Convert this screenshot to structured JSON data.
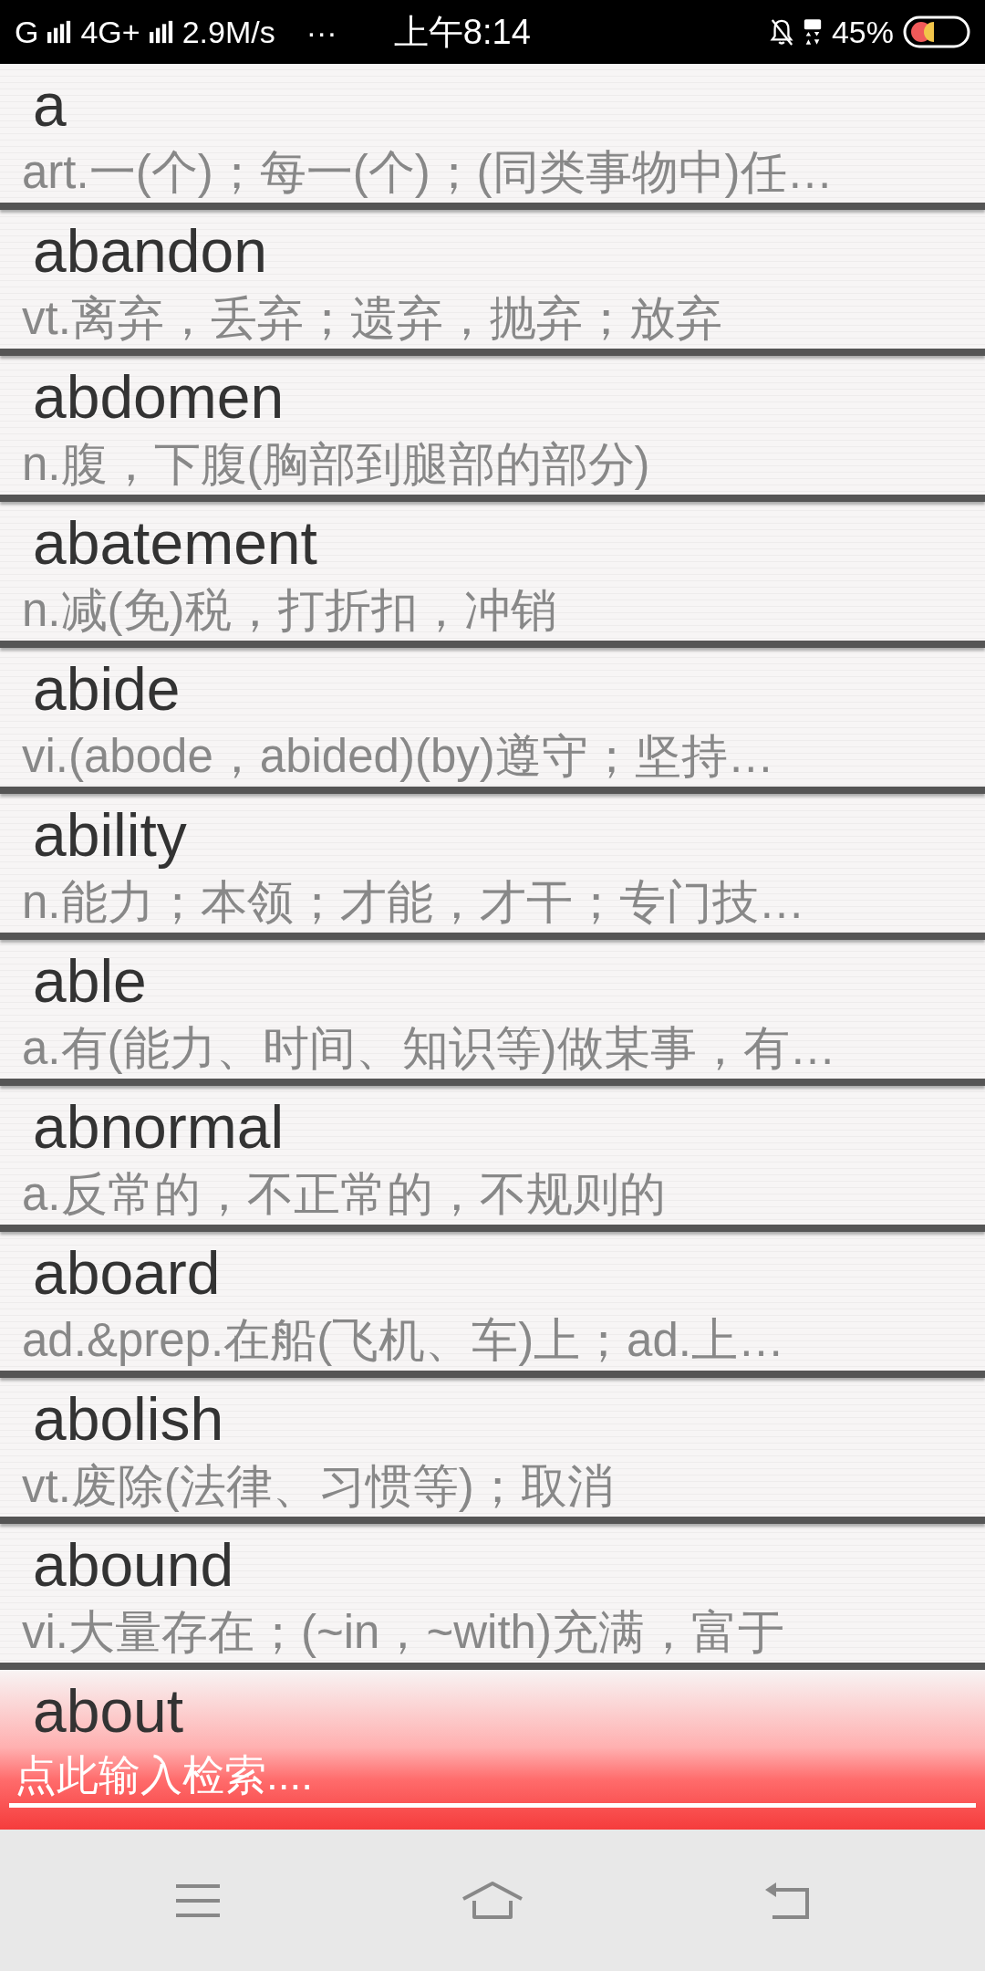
{
  "status_bar": {
    "network_1": "G",
    "network_2": "4G+",
    "speed": "2.9M/s",
    "more": "···",
    "time": "上午8:14",
    "battery": "45%"
  },
  "entries": [
    {
      "word": "a",
      "definition": "art.一(个)；每一(个)；(同类事物中)任…"
    },
    {
      "word": "abandon",
      "definition": "vt.离弃，丢弃；遗弃，抛弃；放弃"
    },
    {
      "word": "abdomen",
      "definition": "n.腹，下腹(胸部到腿部的部分)"
    },
    {
      "word": "abatement",
      "definition": "n.减(免)税，打折扣，冲销"
    },
    {
      "word": "abide",
      "definition": "vi.(abode，abided)(by)遵守；坚持…"
    },
    {
      "word": "ability",
      "definition": "n.能力；本领；才能，才干；专门技…"
    },
    {
      "word": "able",
      "definition": "a.有(能力、时间、知识等)做某事，有…"
    },
    {
      "word": "abnormal",
      "definition": "a.反常的，不正常的，不规则的"
    },
    {
      "word": "aboard",
      "definition": "ad.&prep.在船(飞机、车)上；ad.上…"
    },
    {
      "word": "abolish",
      "definition": "vt.废除(法律、习惯等)；取消"
    },
    {
      "word": "abound",
      "definition": "vi.大量存在；(~in，~with)充满，富于"
    },
    {
      "word": "about"
    }
  ],
  "search": {
    "placeholder": "点此输入检索...."
  }
}
